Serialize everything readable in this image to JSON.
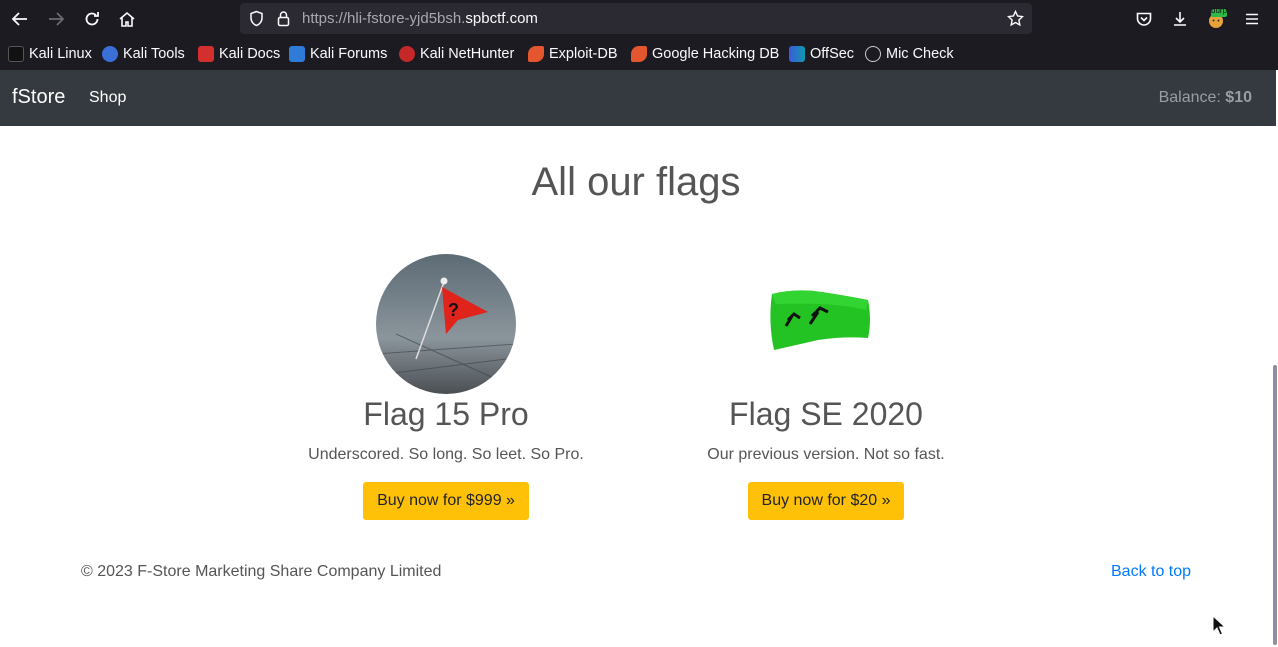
{
  "browser": {
    "url_prefix": "https://hli-fstore-yjd5bsh.",
    "url_host": "spbctf.com",
    "extension_badge": "burp"
  },
  "bookmarks": [
    {
      "label": "Kali Linux",
      "color": "#111111"
    },
    {
      "label": "Kali Tools",
      "color": "#3a6fd8"
    },
    {
      "label": "Kali Docs",
      "color": "#d32f2f"
    },
    {
      "label": "Kali Forums",
      "color": "#2f7bd8"
    },
    {
      "label": "Kali NetHunter",
      "color": "#c62828"
    },
    {
      "label": "Exploit-DB",
      "color": "#e4572e"
    },
    {
      "label": "Google Hacking DB",
      "color": "#e4572e"
    },
    {
      "label": "OffSec",
      "color": "#3b5bdb"
    },
    {
      "label": "Mic Check",
      "color": "#cccccc"
    }
  ],
  "navbar": {
    "brand": "fStore",
    "shop": "Shop",
    "balance_label": "Balance:",
    "balance_value": "$10"
  },
  "main": {
    "title": "All our flags",
    "products": [
      {
        "name": "Flag 15 Pro",
        "description": "Underscored. So long. So leet. So Pro.",
        "button": "Buy now for $999 »"
      },
      {
        "name": "Flag SE 2020",
        "description": "Our previous version. Not so fast.",
        "button": "Buy now for $20 »"
      }
    ]
  },
  "footer": {
    "copyright": "© 2023 F-Store Marketing Share Company Limited",
    "back_to_top": "Back to top"
  },
  "colors": {
    "navbar_bg": "#343a40",
    "button_bg": "#ffc107",
    "link": "#007bff"
  }
}
